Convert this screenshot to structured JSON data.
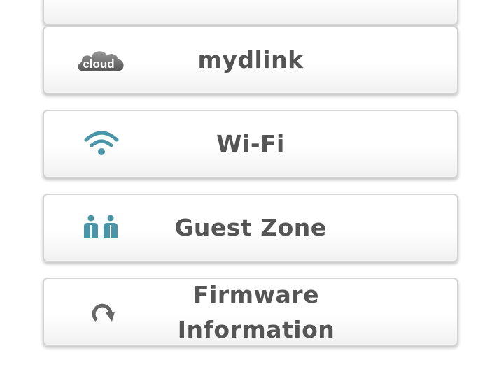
{
  "menu": {
    "items": [
      {
        "label": "mydlink",
        "icon": "mydlink-cloud-icon",
        "logo_text": "cloud"
      },
      {
        "label": "Wi-Fi",
        "icon": "wifi-icon"
      },
      {
        "label": "Guest Zone",
        "icon": "guest-users-icon"
      },
      {
        "label": "Firmware Information",
        "icon": "firmware-update-icon"
      }
    ]
  },
  "colors": {
    "label": "#555555",
    "icon_accent": "#4a95a8",
    "card_border": "#d4d4d4"
  }
}
